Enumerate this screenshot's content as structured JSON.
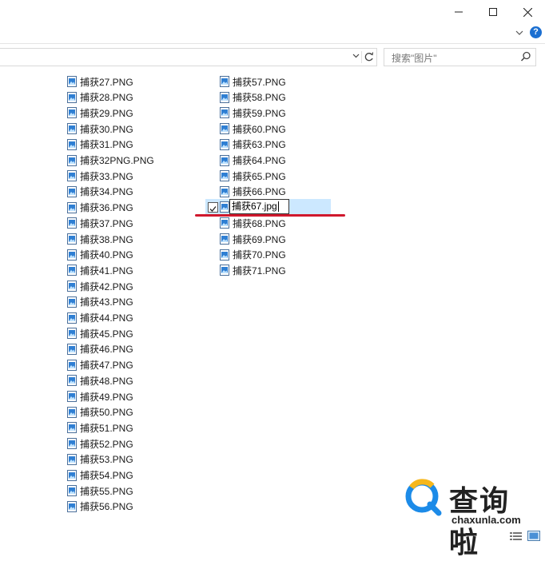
{
  "window": {
    "minimize": "—",
    "maximize": "☐",
    "close": "✕"
  },
  "ribbon": {
    "expand_icon": "chevron-down-icon",
    "help": "?"
  },
  "address_bar": {
    "value": ""
  },
  "search": {
    "placeholder": "搜索\"图片\""
  },
  "files_col1": [
    "捕获27.PNG",
    "捕获28.PNG",
    "捕获29.PNG",
    "捕获30.PNG",
    "捕获31.PNG",
    "捕获32PNG.PNG",
    "捕获33.PNG",
    "捕获34.PNG",
    "捕获36.PNG",
    "捕获37.PNG",
    "捕获38.PNG",
    "捕获40.PNG",
    "捕获41.PNG",
    "捕获42.PNG",
    "捕获43.PNG",
    "捕获44.PNG",
    "捕获45.PNG",
    "捕获46.PNG",
    "捕获47.PNG",
    "捕获48.PNG",
    "捕获49.PNG",
    "捕获50.PNG",
    "捕获51.PNG",
    "捕获52.PNG",
    "捕获53.PNG",
    "捕获54.PNG",
    "捕获55.PNG",
    "捕获56.PNG"
  ],
  "files_col2": [
    "捕获57.PNG",
    "捕获58.PNG",
    "捕获59.PNG",
    "捕获60.PNG",
    "捕获63.PNG",
    "捕获64.PNG",
    "捕获65.PNG",
    "捕获66.PNG",
    "",
    "捕获68.PNG",
    "捕获69.PNG",
    "捕获70.PNG",
    "捕获71.PNG"
  ],
  "renaming": {
    "value": "捕获67.jpg",
    "selected": true
  },
  "watermark": {
    "brand": "查询啦",
    "domain": "chaxunla.com"
  },
  "colors": {
    "selection": "#cce8ff",
    "accent": "#1b6fd1",
    "underline": "#d0182d"
  }
}
